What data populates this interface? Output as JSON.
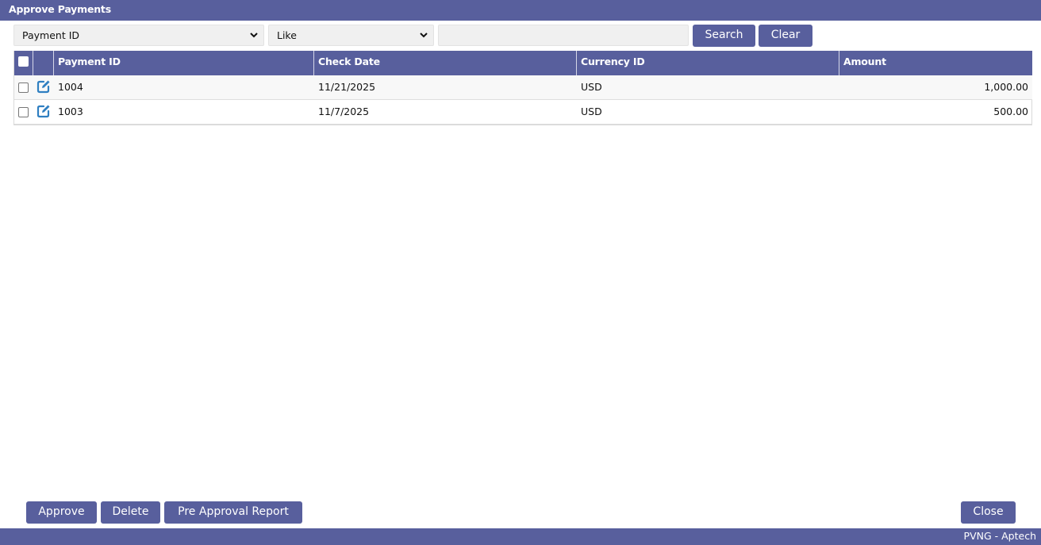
{
  "window": {
    "title": "Approve Payments"
  },
  "filter": {
    "field_value": "Payment ID",
    "operator_value": "Like",
    "search_text": "",
    "search_label": "Search",
    "clear_label": "Clear"
  },
  "table": {
    "columns": [
      "Payment ID",
      "Check Date",
      "Currency ID",
      "Amount"
    ],
    "rows": [
      {
        "payment_id": "1004",
        "check_date": "11/21/2025",
        "currency_id": "USD",
        "amount": "1,000.00",
        "checked": false
      },
      {
        "payment_id": "1003",
        "check_date": "11/7/2025",
        "currency_id": "USD",
        "amount": "500.00",
        "checked": false
      }
    ]
  },
  "actions": {
    "approve_label": "Approve",
    "delete_label": "Delete",
    "pre_approval_label": "Pre Approval Report",
    "close_label": "Close"
  },
  "status": {
    "text": "PVNG - Aptech"
  },
  "colors": {
    "accent": "#585f9d",
    "icon_blue": "#2f7fc1"
  },
  "icons": {
    "row_edit": "edit-icon",
    "dropdown": "chevron-down-icon"
  }
}
